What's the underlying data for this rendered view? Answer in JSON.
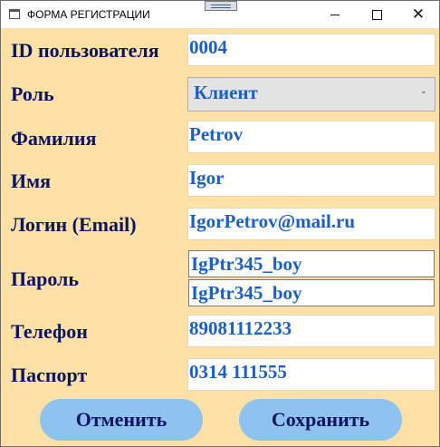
{
  "window": {
    "title": "ФОРМА РЕГИСТРАЦИИ"
  },
  "form": {
    "user_id": {
      "label": "ID пользователя",
      "value": "0004"
    },
    "role": {
      "label": "Роль",
      "value": "Клиент"
    },
    "last_name": {
      "label": "Фамилия",
      "value": "Petrov"
    },
    "first_name": {
      "label": "Имя",
      "value": "Igor"
    },
    "login": {
      "label": "Логин (Email)",
      "value": "IgorPetrov@mail.ru"
    },
    "password": {
      "label": "Пароль",
      "value": "IgPtr345_boy",
      "confirm_value": "IgPtr345_boy"
    },
    "phone": {
      "label": "Телефон",
      "value": "89081112233"
    },
    "passport": {
      "label": "Паспорт",
      "value": "0314 111555"
    }
  },
  "buttons": {
    "cancel": "Отменить",
    "save": "Сохранить"
  },
  "colors": {
    "background": "#ffe0a6",
    "label": "#0b1463",
    "value": "#1a5fc4",
    "button": "#8fc3ef"
  },
  "icons": [
    "window-icon",
    "minimize-icon",
    "maximize-icon",
    "close-icon",
    "chevron-down-icon",
    "drag-grip-icon"
  ]
}
